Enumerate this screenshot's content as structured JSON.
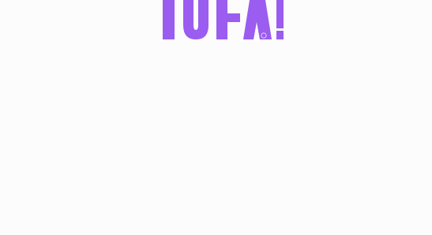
{
  "brand": {
    "logo_text": "TOFA!",
    "logo_color": "#9b5cf0"
  },
  "page": {
    "background": "#fcfcfc"
  }
}
